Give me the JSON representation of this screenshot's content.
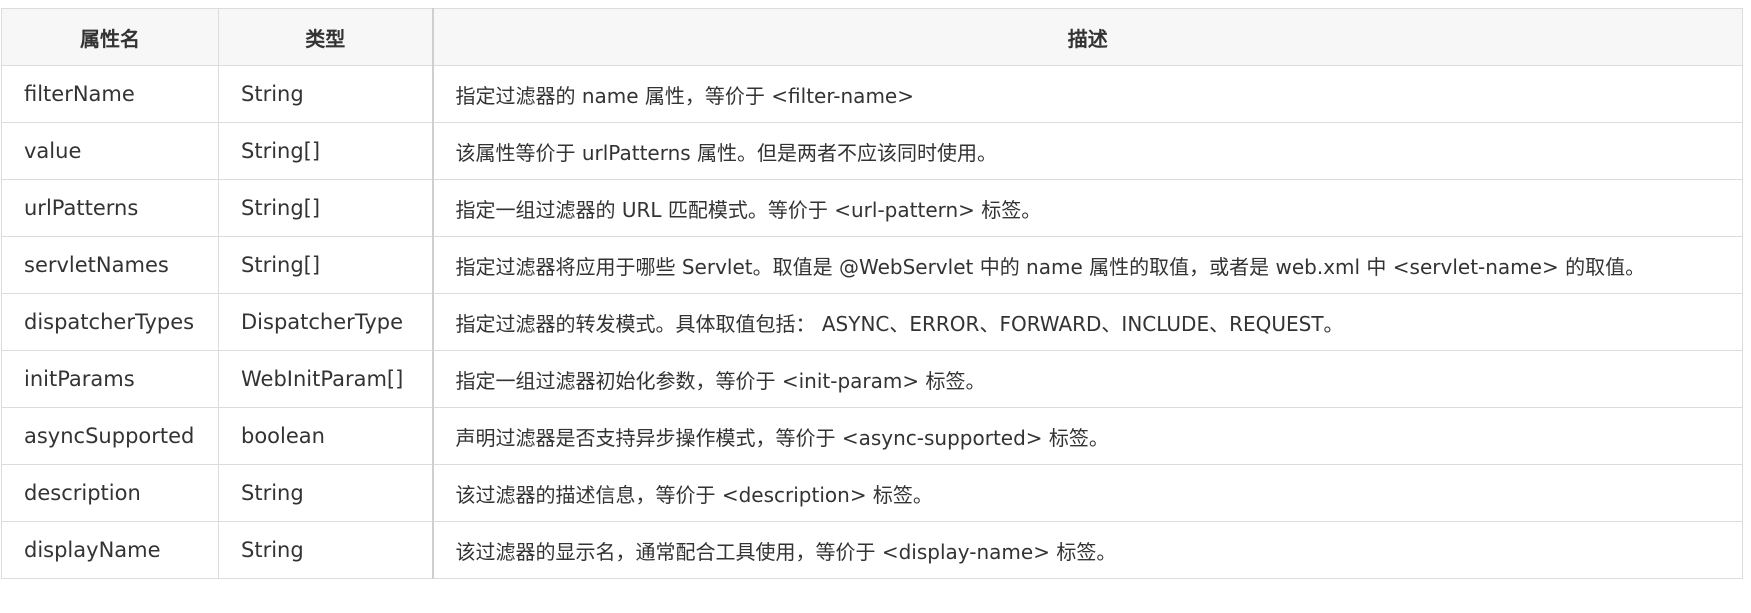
{
  "table": {
    "headers": [
      "属性名",
      "类型",
      "描述"
    ],
    "rows": [
      {
        "name": "filterName",
        "type": "String",
        "desc": "指定过滤器的 name 属性，等价于 <filter-name>"
      },
      {
        "name": "value",
        "type": "String[]",
        "desc": "该属性等价于 urlPatterns 属性。但是两者不应该同时使用。"
      },
      {
        "name": "urlPatterns",
        "type": "String[]",
        "desc": "指定一组过滤器的 URL 匹配模式。等价于 <url-pattern> 标签。"
      },
      {
        "name": "servletNames",
        "type": "String[]",
        "desc": "指定过滤器将应用于哪些 Servlet。取值是 @WebServlet 中的 name 属性的取值，或者是 web.xml 中 <servlet-name> 的取值。"
      },
      {
        "name": "dispatcherTypes",
        "type": "DispatcherType",
        "desc": "指定过滤器的转发模式。具体取值包括： ASYNC、ERROR、FORWARD、INCLUDE、REQUEST。"
      },
      {
        "name": "initParams",
        "type": "WebInitParam[]",
        "desc": "指定一组过滤器初始化参数，等价于 <init-param> 标签。"
      },
      {
        "name": "asyncSupported",
        "type": "boolean",
        "desc": "声明过滤器是否支持异步操作模式，等价于 <async-supported> 标签。"
      },
      {
        "name": "description",
        "type": "String",
        "desc": "该过滤器的描述信息，等价于 <description> 标签。"
      },
      {
        "name": "displayName",
        "type": "String",
        "desc": "该过滤器的显示名，通常配合工具使用，等价于 <display-name> 标签。"
      }
    ]
  }
}
